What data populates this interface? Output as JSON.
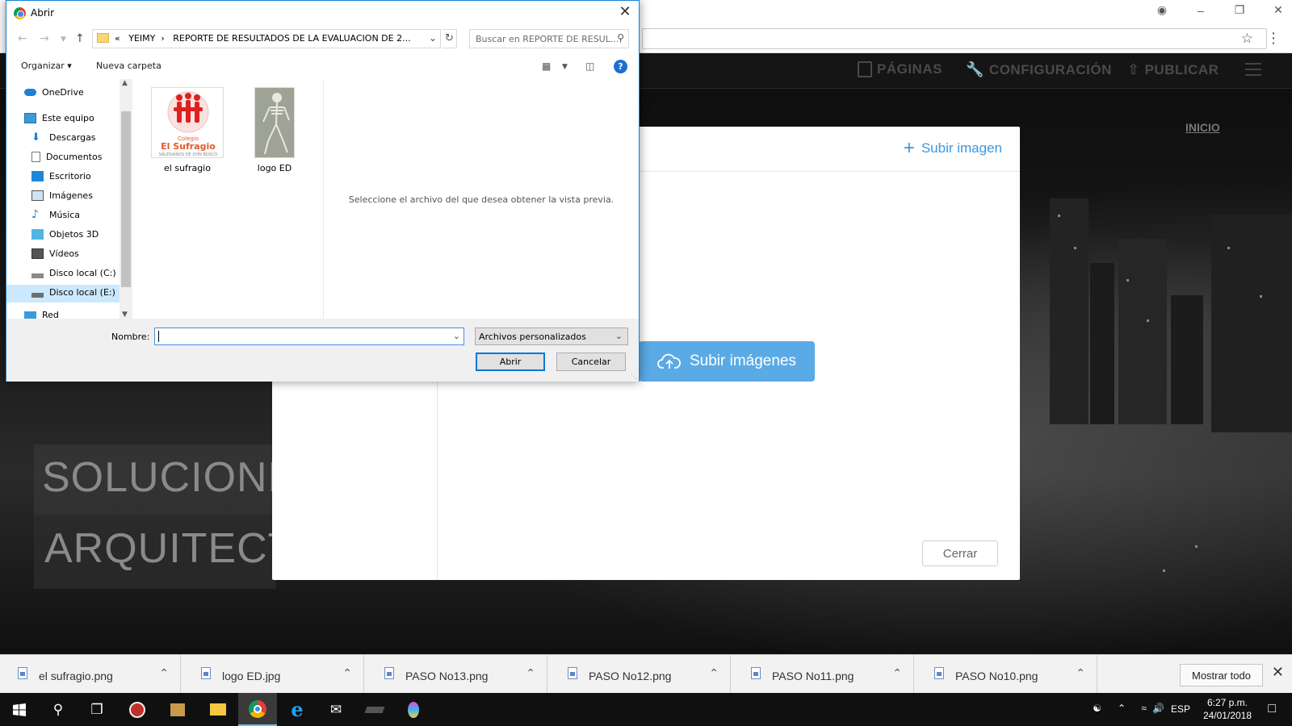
{
  "dialog": {
    "title": "Abrir",
    "address_prefix": "«",
    "address_parts": [
      "YEIMY",
      "REPORTE DE RESULTADOS DE LA EVALUACION DE 2..."
    ],
    "search_placeholder": "Buscar en REPORTE DE RESUL...",
    "toolbar": {
      "organize": "Organizar",
      "new_folder": "Nueva carpeta"
    },
    "nav_tree": [
      {
        "label": "OneDrive",
        "icon": "cloud-icon"
      },
      {
        "label": "Este equipo",
        "icon": "computer-icon"
      },
      {
        "label": "Descargas",
        "icon": "download-icon"
      },
      {
        "label": "Documentos",
        "icon": "document-icon"
      },
      {
        "label": "Escritorio",
        "icon": "desktop-icon"
      },
      {
        "label": "Imágenes",
        "icon": "pictures-icon"
      },
      {
        "label": "Música",
        "icon": "music-icon"
      },
      {
        "label": "Objetos 3D",
        "icon": "cube-icon"
      },
      {
        "label": "Vídeos",
        "icon": "video-icon"
      },
      {
        "label": "Disco local (C:)",
        "icon": "drive-icon"
      },
      {
        "label": "Disco local (E:)",
        "icon": "drive-icon"
      },
      {
        "label": "Red",
        "icon": "network-icon"
      }
    ],
    "files": [
      {
        "name": "el sufragio",
        "logo_line1": "Colegio",
        "logo_line2": "El Sufragio",
        "logo_line3": "SALESIANOS DE DON BOSCO"
      },
      {
        "name": "logo ED"
      }
    ],
    "preview_message": "Seleccione el archivo del que desea obtener la vista previa.",
    "nombre_label": "Nombre:",
    "nombre_value": "",
    "filetype_value": "Archivos personalizados",
    "open_button": "Abrir",
    "cancel_button": "Cancelar"
  },
  "page": {
    "nav": {
      "pages": "PÁGINAS",
      "settings": "CONFIGURACIÓN",
      "publish": "PUBLICAR"
    },
    "inicio": "INICIO",
    "hero_line1": "SOLUCIONE",
    "hero_line2": "ARQUITECT"
  },
  "modal": {
    "upload_link": "Subir imagen",
    "upload_button": "Subir imágenes",
    "close_button": "Cerrar"
  },
  "downloads": {
    "items": [
      "el sufragio.png",
      "logo ED.jpg",
      "PASO No13.png",
      "PASO No12.png",
      "PASO No11.png",
      "PASO No10.png"
    ],
    "show_all": "Mostrar todo"
  },
  "taskbar": {
    "language": "ESP",
    "time": "6:27 p.m.",
    "date": "24/01/2018"
  },
  "colors": {
    "accent_blue": "#3b97de",
    "upload_button_bg": "#5aaae6",
    "dialog_border": "#1883d7",
    "selection": "#cce8ff",
    "sufragio_red": "#e02020"
  }
}
